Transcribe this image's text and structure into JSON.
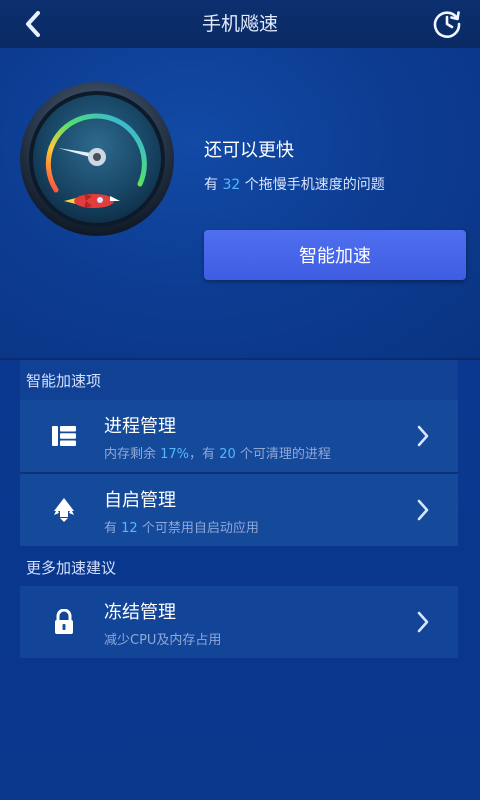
{
  "header": {
    "title": "手机飚速"
  },
  "hero": {
    "headline": "还可以更快",
    "problem_prefix": "有 ",
    "problem_count": "32",
    "problem_suffix": " 个拖慢手机速度的问题",
    "boost_button": "智能加速"
  },
  "sections": {
    "smart": "智能加速项",
    "more": "更多加速建议"
  },
  "items": [
    {
      "title": "进程管理",
      "desc_prefix": "内存剩余 ",
      "desc_value1": "17%",
      "desc_middle": "，有 ",
      "desc_value2": "20",
      "desc_suffix": " 个可清理的进程"
    },
    {
      "title": "自启管理",
      "desc_prefix": "有 ",
      "desc_value1": "12",
      "desc_suffix": " 个可禁用自启动应用"
    },
    {
      "title": "冻结管理",
      "desc": "减少CPU及内存占用"
    }
  ],
  "icons": {
    "back": "chevron-left-icon",
    "history": "clock-refresh-icon",
    "gauge": "speedometer-icon",
    "process": "list-icon",
    "autostart": "rocket-icon",
    "freeze": "lock-icon",
    "chevron": "chevron-right-icon"
  },
  "colors": {
    "accent_number": "#52b9ff",
    "button": "#4a68ea",
    "background": "#0c3a8e"
  }
}
